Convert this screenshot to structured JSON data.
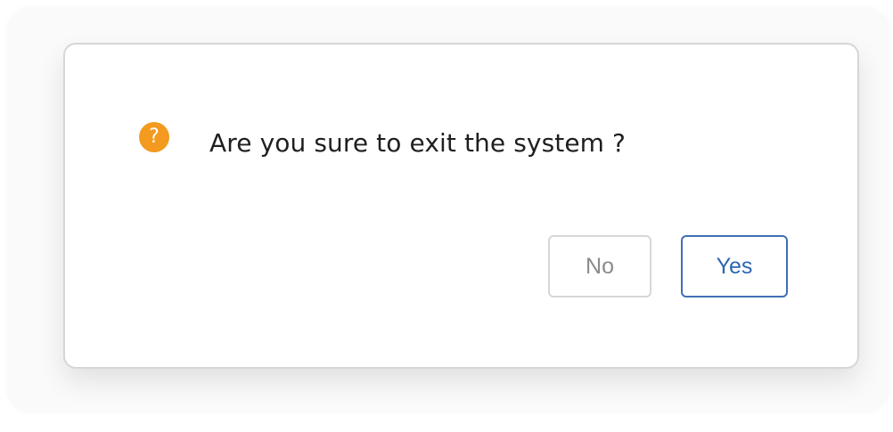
{
  "dialog": {
    "icon": "question-icon",
    "icon_glyph": "?",
    "message": "Are you sure to exit the system ?",
    "buttons": {
      "no_label": "No",
      "yes_label": "Yes"
    }
  },
  "colors": {
    "icon_background": "#f39a1f",
    "primary": "#3f6fb3",
    "text": "#1f1f1f",
    "secondary_text": "#8b8b8b",
    "border": "#d6d6d6"
  }
}
